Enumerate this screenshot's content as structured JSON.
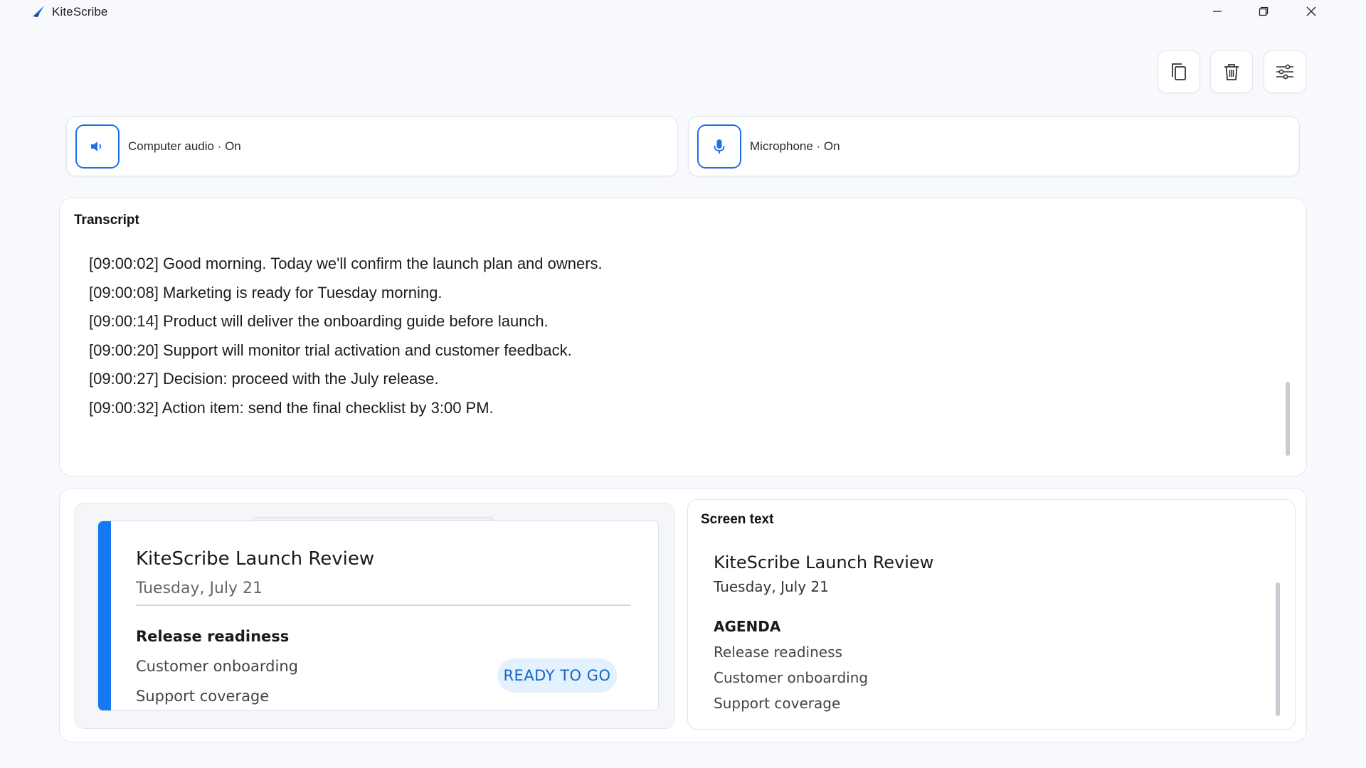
{
  "app": {
    "title": "KiteScribe",
    "accent": "#1f6feb"
  },
  "window_controls": {
    "minimize": "minimize-icon",
    "maximize": "restore-icon",
    "close": "close-icon"
  },
  "toolbar": {
    "copy_icon": "copy-icon",
    "delete_icon": "trash-icon",
    "settings_icon": "sliders-icon"
  },
  "sources": {
    "computer_audio": {
      "label": "Computer audio · On",
      "icon": "speaker-icon"
    },
    "microphone": {
      "label": "Microphone · On",
      "icon": "microphone-icon"
    }
  },
  "transcript": {
    "title": "Transcript",
    "lines": [
      "[09:00:02] Good morning. Today we'll confirm the launch plan and owners.",
      "[09:00:08] Marketing is ready for Tuesday morning.",
      "[09:00:14] Product will deliver the onboarding guide before launch.",
      "[09:00:20] Support will monitor trial activation and customer feedback.",
      "[09:00:27] Decision: proceed with the July release.",
      "[09:00:32] Action item: send the final checklist by 3:00 PM."
    ]
  },
  "slide_preview": {
    "title": "KiteScribe Launch Review",
    "date": "Tuesday, July 21",
    "agenda_heading": "Release readiness",
    "agenda_items": [
      "Customer onboarding",
      "Support coverage"
    ],
    "badge": "READY TO GO",
    "accent": "#1479f2"
  },
  "screen_text": {
    "title": "Screen text",
    "doc_title": "KiteScribe Launch Review",
    "date": "Tuesday, July 21",
    "agenda_heading": "AGENDA",
    "items": [
      "Release readiness",
      "Customer onboarding",
      "Support coverage"
    ]
  }
}
